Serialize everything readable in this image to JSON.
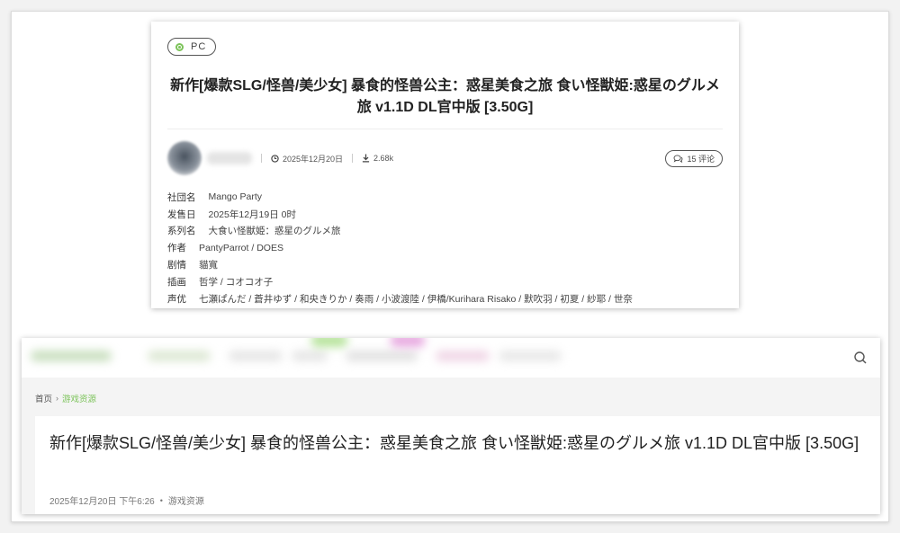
{
  "top_card": {
    "platform_tag": "PC",
    "title": "新作[爆款SLG/怪兽/美少女] 暴食的怪兽公主：惑星美食之旅 食い怪獣姫:惑星のグルメ旅 v1.1D DL官中版 [3.50G]",
    "date": "2025年12月20日",
    "downloads": "2.68k",
    "comments_label": "15 评论",
    "info": [
      {
        "key": "社団名",
        "value": "Mango Party"
      },
      {
        "key": "发售日",
        "value": "2025年12月19日 0时"
      },
      {
        "key": "系列名",
        "value": "大食い怪獣姫：惑星のグルメ旅"
      },
      {
        "key": "作者",
        "value": "PantyParrot / DOES"
      },
      {
        "key": "剧情",
        "value": "貓寬"
      },
      {
        "key": "插画",
        "value": "哲学 / コオコオ子"
      },
      {
        "key": "声优",
        "value": "七瀬ぱんだ / 蒼井ゆず / 和央きりか / 奏雨 / 小波渡陸 / 伊橋/Kurihara Risako / 默吹羽 / 初夏 / 紗耶 / 世奈"
      }
    ]
  },
  "bottom_card": {
    "breadcrumb": {
      "home": "首页",
      "current": "游戏资源"
    },
    "title": "新作[爆款SLG/怪兽/美少女] 暴食的怪兽公主：惑星美食之旅 食い怪獣姫:惑星のグルメ旅 v1.1D DL官中版 [3.50G]",
    "date": "2025年12月20日 下午6:26",
    "category": "游戏资源"
  },
  "colors": {
    "accent": "#7cc35a"
  },
  "icons": [
    "platform-dot-icon",
    "clock-icon",
    "download-icon",
    "comment-icon",
    "search-icon",
    "chevron-right-icon"
  ]
}
